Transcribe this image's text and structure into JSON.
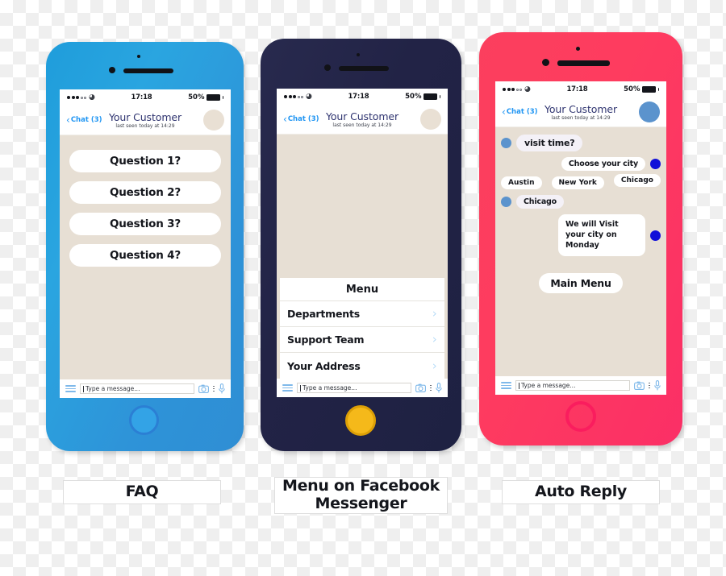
{
  "status_bar": {
    "signal_filled": 3,
    "signal_empty": 2,
    "wifi_icon": "wifi-icon",
    "time": "17:18",
    "battery_percent": "50%"
  },
  "chat_header": {
    "back_label": "Chat (3)",
    "back_icon": "chevron-left-icon",
    "customer_name": "Your Customer",
    "last_seen": "last seen today at 14:29",
    "avatar_icon": "avatar"
  },
  "input_bar": {
    "menu_icon": "hamburger-icon",
    "placeholder": "Type a message...",
    "camera_icon": "camera-icon",
    "more_icon": "more-vertical-icon",
    "mic_icon": "microphone-icon"
  },
  "phone1": {
    "frame_color": "#2aa5e0",
    "home_button_color": "#33a3e6",
    "avatar_color": "#e9e0d4",
    "faq_buttons": [
      {
        "label": "Question 1?"
      },
      {
        "label": "Question 2?"
      },
      {
        "label": "Question 3?"
      },
      {
        "label": "Question 4?"
      }
    ],
    "caption": "FAQ"
  },
  "phone2": {
    "frame_color": "#222346",
    "home_button_color": "#f5b91a",
    "avatar_color": "#e9e0d4",
    "menu_title": "Menu",
    "menu_items": [
      {
        "label": "Departments",
        "chevron": "chevron-right-icon"
      },
      {
        "label": "Support Team",
        "chevron": "chevron-right-icon"
      },
      {
        "label": "Your Address",
        "chevron": "chevron-right-icon"
      }
    ],
    "caption": "Menu on Facebook Messenger",
    "caption_line1": "Menu on Facebook",
    "caption_line2": "Messenger"
  },
  "phone3": {
    "frame_color": "#fb3f5e",
    "home_button_color": "#fa1d5e",
    "avatar_color": "#5b93cd",
    "messages": [
      {
        "side": "in",
        "text": "visit time?"
      },
      {
        "side": "out",
        "text": "Choose your city"
      }
    ],
    "city_chips": [
      {
        "label": "Austin"
      },
      {
        "label": "New York"
      },
      {
        "label": "Chicago"
      }
    ],
    "reply_chip": "Chicago",
    "final_message": "We will Visit your city on Monday",
    "main_menu_label": "Main Menu",
    "caption": "Auto Reply"
  }
}
